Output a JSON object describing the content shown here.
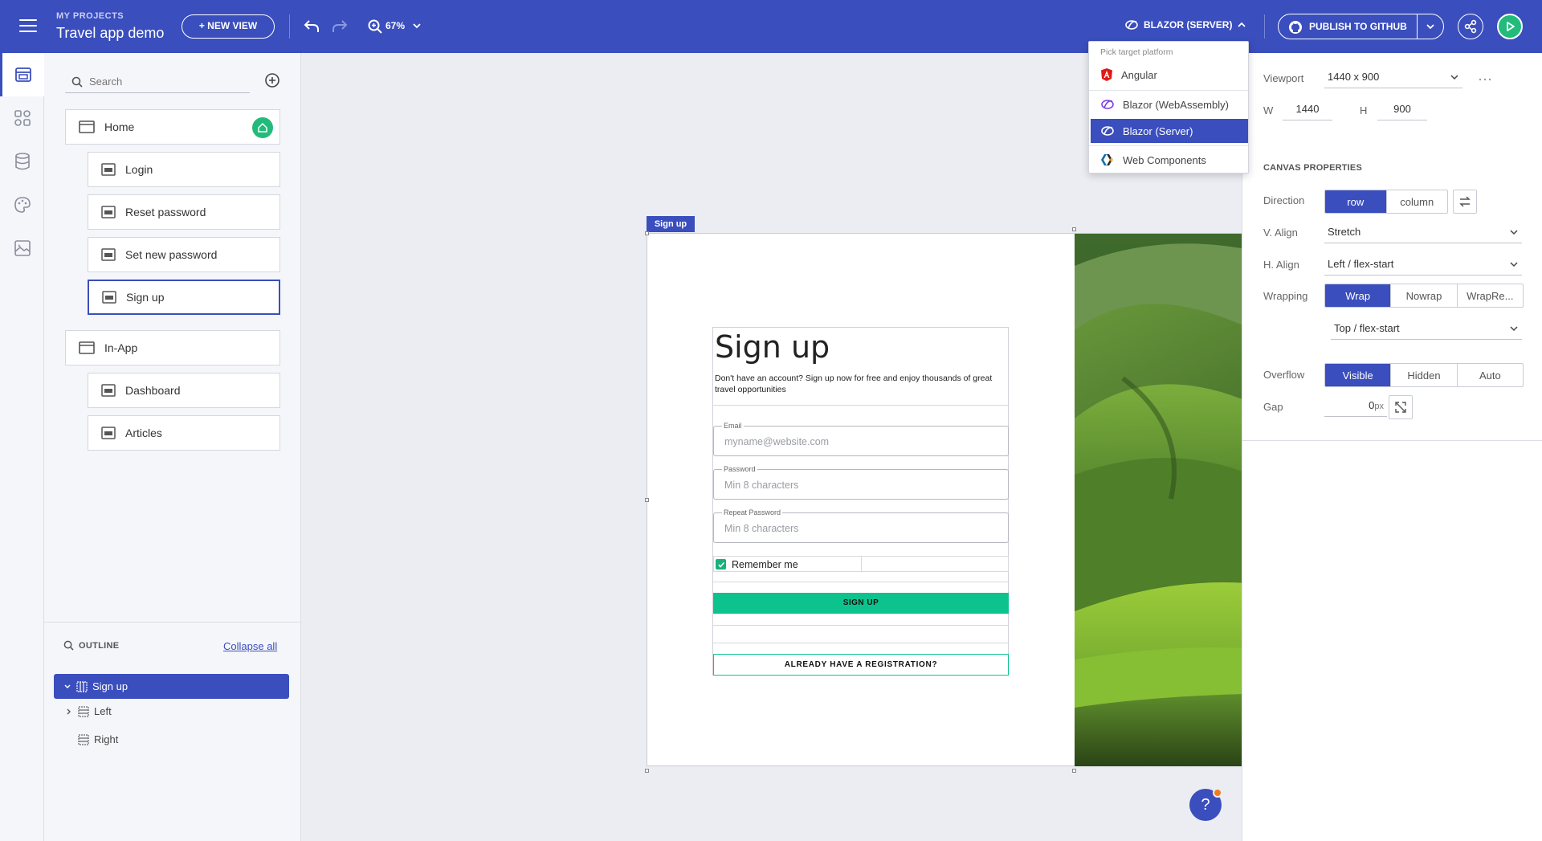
{
  "header": {
    "project_label": "MY PROJECTS",
    "project_name": "Travel app demo",
    "new_view_label": "+ NEW VIEW",
    "zoom": "67%",
    "platform_label": "BLAZOR (SERVER)",
    "publish_label": "PUBLISH TO GITHUB"
  },
  "rail": {
    "items": [
      "views-icon",
      "components-icon",
      "data-icon",
      "theme-icon",
      "assets-icon"
    ]
  },
  "views_panel": {
    "search_placeholder": "Search",
    "items": [
      {
        "label": "Home",
        "level": 0,
        "home": true
      },
      {
        "label": "Login",
        "level": 1
      },
      {
        "label": "Reset password",
        "level": 1
      },
      {
        "label": "Set new password",
        "level": 1
      },
      {
        "label": "Sign up",
        "level": 1,
        "selected": true
      },
      {
        "label": "In-App",
        "level": 0
      },
      {
        "label": "Dashboard",
        "level": 1
      },
      {
        "label": "Articles",
        "level": 1
      }
    ]
  },
  "outline": {
    "title": "OUTLINE",
    "collapse_label": "Collapse all",
    "items": [
      {
        "label": "Sign up",
        "selected": true
      },
      {
        "label": "Left"
      },
      {
        "label": "Right"
      }
    ]
  },
  "canvas": {
    "frame_tag": "Sign up",
    "form": {
      "title": "Sign up",
      "subtitle": "Don't have an account? Sign up now for free and enjoy thousands of great travel opportunities",
      "email_label": "Email",
      "email_placeholder": "myname@website.com",
      "password_label": "Password",
      "password_placeholder": "Min 8 characters",
      "repeat_label": "Repeat Password",
      "repeat_placeholder": "Min 8 characters",
      "remember_label": "Remember me",
      "remember_checked": true,
      "signup_button": "SIGN UP",
      "already_button": "ALREADY HAVE A REGISTRATION?"
    },
    "help_label": "?"
  },
  "properties": {
    "viewport_label": "Viewport",
    "viewport_value": "1440 x 900",
    "w_label": "W",
    "w_value": "1440",
    "h_label": "H",
    "h_value": "900",
    "section_title": "CANVAS PROPERTIES",
    "direction_label": "Direction",
    "direction_options": [
      "row",
      "column"
    ],
    "direction_selected": "row",
    "valign_label": "V. Align",
    "valign_value": "Stretch",
    "halign_label": "H. Align",
    "halign_value": "Left / flex-start",
    "wrapping_label": "Wrapping",
    "wrapping_options": [
      "Wrap",
      "Nowrap",
      "WrapRe..."
    ],
    "wrapping_selected": "Wrap",
    "wrap_align_value": "Top / flex-start",
    "overflow_label": "Overflow",
    "overflow_options": [
      "Visible",
      "Hidden",
      "Auto"
    ],
    "overflow_selected": "Visible",
    "gap_label": "Gap",
    "gap_value": "0",
    "gap_unit": "px"
  },
  "platform_dropdown": {
    "header": "Pick target platform",
    "options": [
      {
        "label": "Angular",
        "icon": "angular-icon"
      },
      {
        "label": "Blazor (WebAssembly)",
        "icon": "blazor-icon"
      },
      {
        "label": "Blazor (Server)",
        "icon": "blazor-icon",
        "selected": true
      },
      {
        "label": "Web Components",
        "icon": "webcomponents-icon"
      }
    ]
  },
  "colors": {
    "brand": "#3a4ebd",
    "accent": "#0cc38d",
    "notification": "#f07b1f"
  }
}
